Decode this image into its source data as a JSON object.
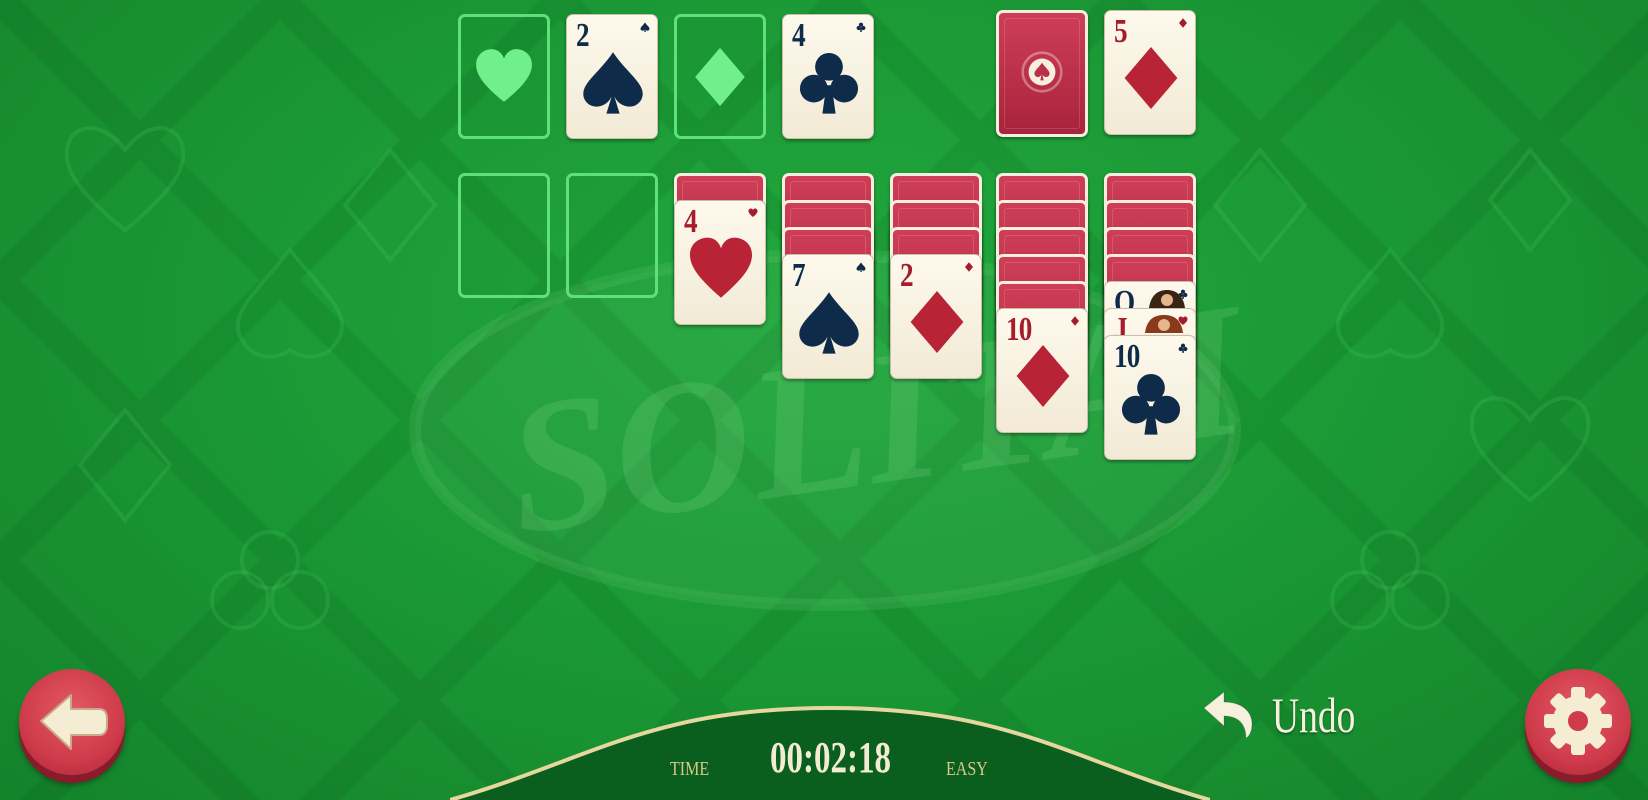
{
  "game": {
    "watermark": "SOLITAIRE"
  },
  "foundations": [
    {
      "state": "empty",
      "suit": "heart"
    },
    {
      "rank": "2",
      "suit": "spade",
      "color": "black"
    },
    {
      "state": "empty",
      "suit": "diamond"
    },
    {
      "rank": "4",
      "suit": "club",
      "color": "black"
    }
  ],
  "stock": {
    "state": "face-down"
  },
  "waste": {
    "rank": "5",
    "suit": "diamond",
    "color": "red"
  },
  "tableau": [
    {
      "face_down": 0,
      "face_up": []
    },
    {
      "face_down": 0,
      "face_up": []
    },
    {
      "face_down": 1,
      "face_up": [
        {
          "rank": "4",
          "suit": "heart",
          "color": "red"
        }
      ]
    },
    {
      "face_down": 3,
      "face_up": [
        {
          "rank": "7",
          "suit": "spade",
          "color": "black"
        }
      ]
    },
    {
      "face_down": 3,
      "face_up": [
        {
          "rank": "2",
          "suit": "diamond",
          "color": "red"
        }
      ]
    },
    {
      "face_down": 5,
      "face_up": [
        {
          "rank": "10",
          "suit": "diamond",
          "color": "red"
        }
      ]
    },
    {
      "face_down": 4,
      "face_up": [
        {
          "rank": "Q",
          "suit": "club",
          "color": "black"
        },
        {
          "rank": "J",
          "suit": "heart",
          "color": "red"
        },
        {
          "rank": "10",
          "suit": "club",
          "color": "black"
        }
      ]
    }
  ],
  "controls": {
    "back_icon": "back-arrow-icon",
    "settings_icon": "gear-icon",
    "undo_icon": "undo-arrow-icon",
    "undo_label": "Undo"
  },
  "status": {
    "time_label": "TIME",
    "time_value": "00:02:18",
    "difficulty": "EASY"
  },
  "colors": {
    "felt": "#1b9a36",
    "card_back": "#b8304a",
    "red_suit": "#a51c2c",
    "black_suit": "#0e2b49",
    "slot_outline": "#5fe079"
  }
}
